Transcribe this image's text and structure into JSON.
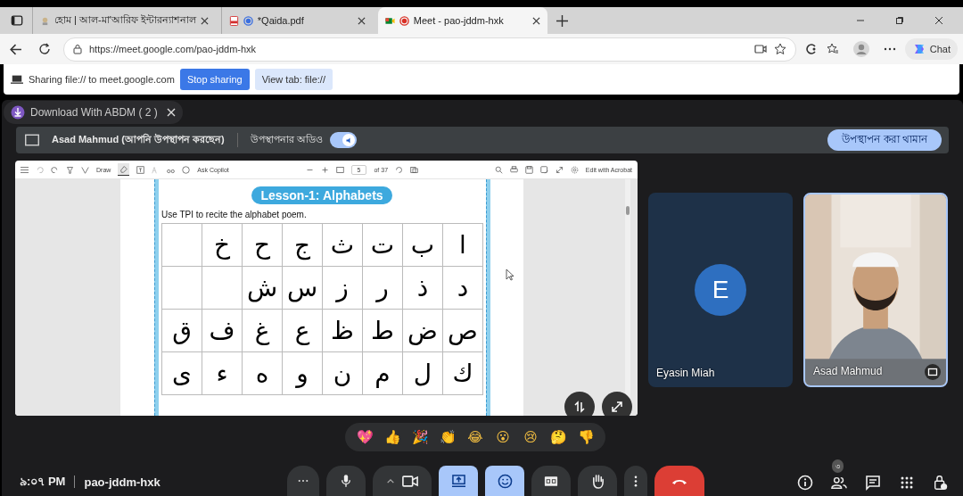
{
  "tabs": [
    {
      "title": "হোম | আল-মা'আরিফ ইন্টারন্যাশনাল",
      "kind": "site",
      "selected": false
    },
    {
      "title": "*Qaida.pdf",
      "kind": "pdf",
      "selected": false
    },
    {
      "title": "Meet - pao-jddm-hxk",
      "kind": "meet",
      "selected": true
    }
  ],
  "address": {
    "url": "https://meet.google.com/pao-jddm-hxk"
  },
  "chat_button": "Chat",
  "share_bar": {
    "message": "Sharing file:// to meet.google.com",
    "stop": "Stop sharing",
    "view": "View tab: file://"
  },
  "download_popup": {
    "label": "Download With ABDM ( 2 )"
  },
  "presenter_bar": {
    "presenter": "Asad Mahmud (আপনি উপস্থাপন করছেন)",
    "audio_label": "উপস্থাপনার অডিও",
    "audio_on": true,
    "stop": "উপস্থাপন করা থামান"
  },
  "pdf": {
    "toolbar": {
      "draw": "Draw",
      "copilot": "Ask Copilot",
      "page": "5",
      "of": "of 37",
      "edit": "Edit with Acrobat"
    },
    "lesson_title": "Lesson-1: Alphabets",
    "instruction": "Use TPI to recite the alphabet poem.",
    "rows": [
      [
        null,
        "خ",
        "ح",
        "ج",
        "ث",
        "ت",
        "ب",
        "ا"
      ],
      [
        null,
        null,
        "ش",
        "س",
        "ز",
        "ر",
        "ذ",
        "د"
      ],
      [
        "ق",
        "ف",
        "غ",
        "ع",
        "ظ",
        "ط",
        "ض",
        "ص"
      ],
      [
        "ى",
        "ء",
        "ه",
        "و",
        "ن",
        "م",
        "ل",
        "ك"
      ]
    ]
  },
  "participants": [
    {
      "name": "Eyasin Miah",
      "kind": "avatar",
      "initial": "E"
    },
    {
      "name": "Asad Mahmud",
      "kind": "video"
    }
  ],
  "reactions": [
    "💖",
    "👍",
    "🎉",
    "👏",
    "😂",
    "😮",
    "😢",
    "🤔",
    "👎"
  ],
  "meeting": {
    "time": "৯:০৭ PM",
    "code": "pao-jddm-hxk"
  },
  "controls": [
    {
      "kind": "more",
      "selected": false
    },
    {
      "kind": "mic",
      "selected": false
    },
    {
      "kind": "camera",
      "selected": false
    },
    {
      "kind": "present",
      "selected": true
    },
    {
      "kind": "emoji",
      "selected": true
    },
    {
      "kind": "captions",
      "selected": false
    },
    {
      "kind": "hand",
      "selected": false
    },
    {
      "kind": "menu",
      "selected": false
    },
    {
      "kind": "end"
    }
  ],
  "side_icons": [
    {
      "kind": "info"
    },
    {
      "kind": "people",
      "badge": "৩"
    },
    {
      "kind": "chat"
    },
    {
      "kind": "apps"
    },
    {
      "kind": "lock"
    }
  ]
}
